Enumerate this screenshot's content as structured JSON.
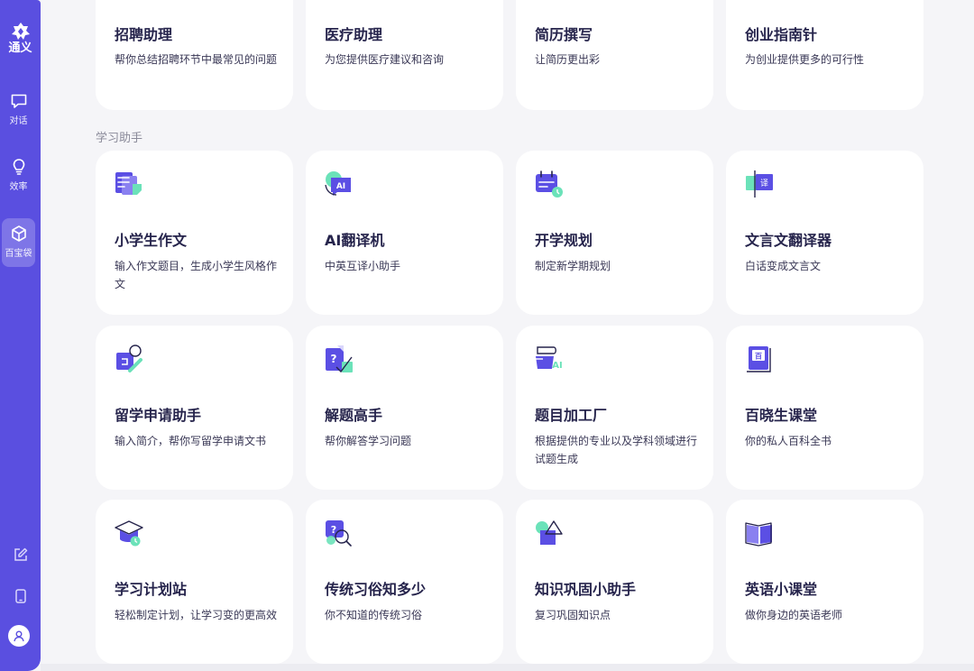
{
  "brand": {
    "name": "通义"
  },
  "nav": [
    {
      "key": "chat",
      "label": "对话",
      "icon": "chat-bubble-icon",
      "active": false
    },
    {
      "key": "efficiency",
      "label": "效率",
      "icon": "lightbulb-icon",
      "active": false
    },
    {
      "key": "toolbox",
      "label": "百宝袋",
      "icon": "cube-icon",
      "active": true
    }
  ],
  "sidebar_bottom": {
    "icons": [
      "edit-icon",
      "tablet-icon",
      "user-icon"
    ]
  },
  "top_cards": [
    {
      "title": "招聘助理",
      "desc": "帮你总结招聘环节中最常见的问题"
    },
    {
      "title": "医疗助理",
      "desc": "为您提供医疗建议和咨询"
    },
    {
      "title": "简历撰写",
      "desc": "让简历更出彩"
    },
    {
      "title": "创业指南针",
      "desc": "为创业提供更多的可行性"
    }
  ],
  "section": {
    "title": "学习助手"
  },
  "study_cards": [
    {
      "title": "小学生作文",
      "desc": "输入作文题目，生成小学生风格作文",
      "icon": "essay-icon"
    },
    {
      "title": "AI翻译机",
      "desc": "中英互译小助手",
      "icon": "ai-translate-icon",
      "icon_text": "AI"
    },
    {
      "title": "开学规划",
      "desc": "制定新学期规划",
      "icon": "calendar-icon"
    },
    {
      "title": "文言文翻译器",
      "desc": "白话变成文言文",
      "icon": "classical-translate-icon",
      "icon_text": "译"
    },
    {
      "title": "留学申请助手",
      "desc": "输入简介，帮你写留学申请文书",
      "icon": "study-abroad-icon"
    },
    {
      "title": "解题高手",
      "desc": "帮你解答学习问题",
      "icon": "question-solve-icon",
      "icon_text": "?"
    },
    {
      "title": "题目加工厂",
      "desc": "根据提供的专业以及学科领域进行试题生成",
      "icon": "question-factory-icon",
      "icon_text": "AI"
    },
    {
      "title": "百晓生课堂",
      "desc": "你的私人百科全书",
      "icon": "encyclopedia-icon",
      "icon_text": "百"
    },
    {
      "title": "学习计划站",
      "desc": "轻松制定计划，让学习变的更高效",
      "icon": "graduation-cap-icon"
    },
    {
      "title": "传统习俗知多少",
      "desc": "你不知道的传统习俗",
      "icon": "search-question-icon",
      "icon_text": "?"
    },
    {
      "title": "知识巩固小助手",
      "desc": "复习巩固知识点",
      "icon": "shapes-icon"
    },
    {
      "title": "英语小课堂",
      "desc": "做你身边的英语老师",
      "icon": "open-book-icon"
    }
  ],
  "colors": {
    "sidebar": "#5a4fe0",
    "accent_purple": "#5b4fe4",
    "accent_green": "#6be2b9",
    "page_bg": "#f5f5f8",
    "card_bg": "#ffffff"
  }
}
